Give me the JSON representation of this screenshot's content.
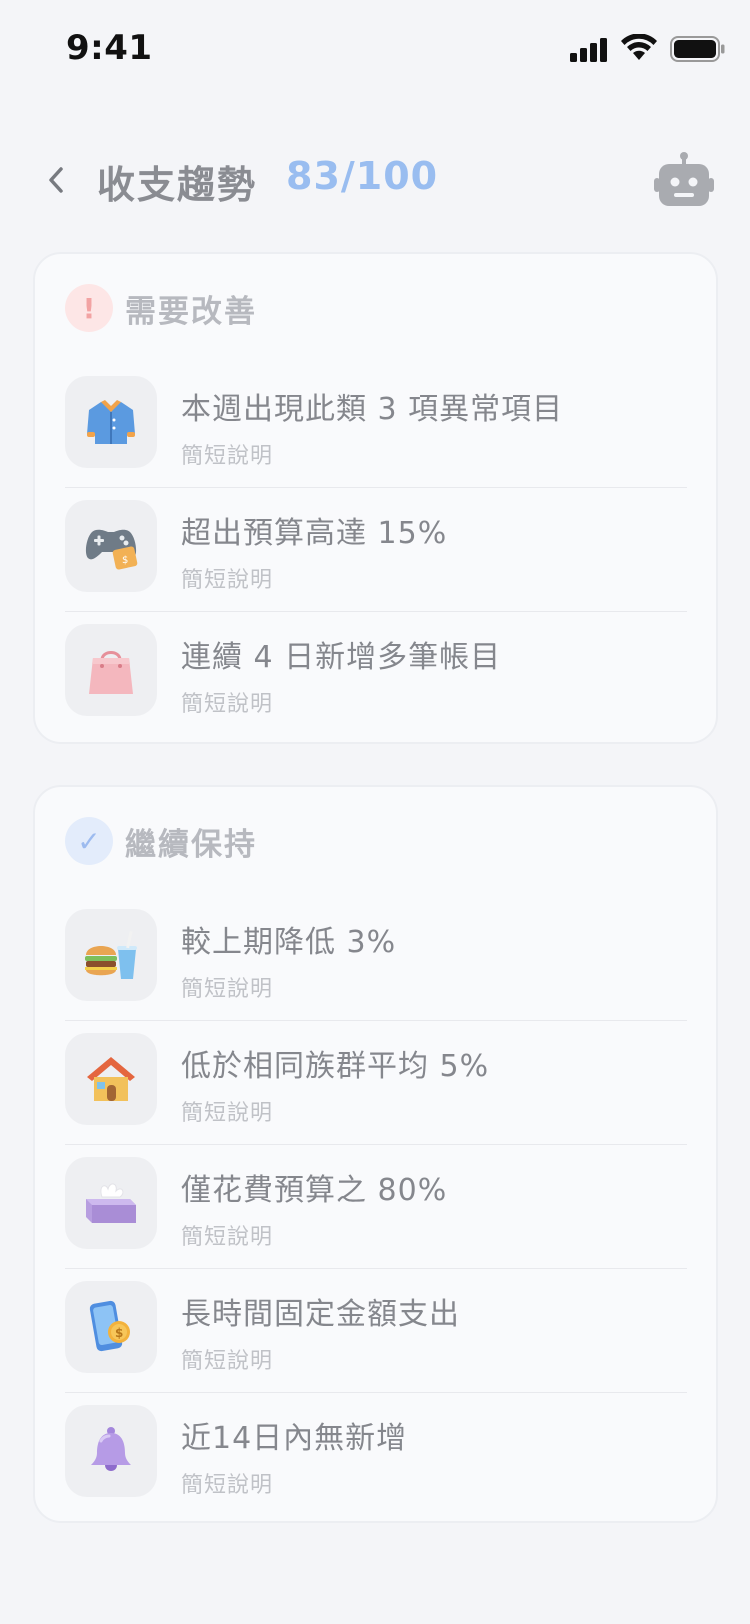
{
  "status_bar": {
    "time": "9:41"
  },
  "header": {
    "title": "收支趨勢",
    "score": "83/100"
  },
  "sections": [
    {
      "title": "需要改善",
      "badge": "!",
      "items": [
        {
          "title": "本週出現此類 3 項異常項目",
          "desc": "簡短說明",
          "icon": "jacket-icon"
        },
        {
          "title": "超出預算高達 15%",
          "desc": "簡短說明",
          "icon": "game-controller-icon"
        },
        {
          "title": "連續 4 日新增多筆帳目",
          "desc": "簡短說明",
          "icon": "shopping-bag-icon"
        }
      ]
    },
    {
      "title": "繼續保持",
      "badge": "✓",
      "items": [
        {
          "title": "較上期降低 3%",
          "desc": "簡短說明",
          "icon": "burger-drink-icon"
        },
        {
          "title": "低於相同族群平均 5%",
          "desc": "簡短說明",
          "icon": "house-icon"
        },
        {
          "title": "僅花費預算之 80%",
          "desc": "簡短說明",
          "icon": "tissue-box-icon"
        },
        {
          "title": "長時間固定金額支出",
          "desc": "簡短說明",
          "icon": "phone-coin-icon"
        },
        {
          "title": "近14日內無新增",
          "desc": "簡短說明",
          "icon": "bell-icon"
        }
      ]
    }
  ],
  "colors": {
    "background": "#f4f5f8",
    "card": "#f9fafc",
    "score_accent": "#99bdf0",
    "warn": "#f2a3a3",
    "ok": "#9dbbef"
  }
}
